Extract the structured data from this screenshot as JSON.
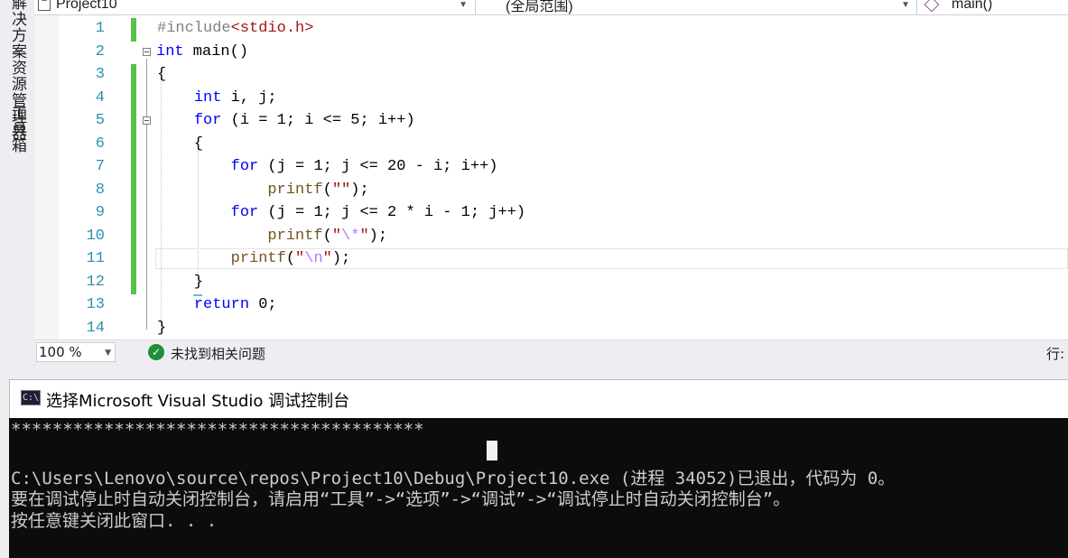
{
  "side_tabs": [
    "解决方案资源管理器",
    "工具箱"
  ],
  "nav": {
    "project": "Project10",
    "scope": "(全局范围)",
    "member": "main()"
  },
  "code": {
    "lines": [
      {
        "num": "1",
        "text": "#include<stdio.h>"
      },
      {
        "num": "2",
        "text": "int main()"
      },
      {
        "num": "3",
        "text": "{"
      },
      {
        "num": "4",
        "text": "    int i, j;"
      },
      {
        "num": "5",
        "text": "    for (i = 1; i <= 5; i++)"
      },
      {
        "num": "6",
        "text": "    {"
      },
      {
        "num": "7",
        "text": "        for (j = 1; j <= 20 - i; i++)"
      },
      {
        "num": "8",
        "text": "            printf(\"\");"
      },
      {
        "num": "9",
        "text": "        for (j = 1; j <= 2 * i - 1; j++)"
      },
      {
        "num": "10",
        "text": "            printf(\"\\*\");"
      },
      {
        "num": "11",
        "text": "        printf(\"\\n\");"
      },
      {
        "num": "12",
        "text": "    }"
      },
      {
        "num": "13",
        "text": "    return 0;"
      },
      {
        "num": "14",
        "text": "}"
      }
    ],
    "changed_lines": [
      "1",
      "3",
      "4",
      "5",
      "6",
      "7",
      "8",
      "9",
      "10",
      "11",
      "12"
    ],
    "current_line": "11"
  },
  "status": {
    "zoom": "100 %",
    "message": "未找到相关问题",
    "row_label": "行:"
  },
  "console": {
    "icon_label": "C:\\",
    "title": "选择Microsoft Visual Studio 调试控制台",
    "lines": [
      "****************************************",
      "",
      "C:\\Users\\Lenovo\\source\\repos\\Project10\\Debug\\Project10.exe (进程 34052)已退出，代码为 0。",
      "要在调试停止时自动关闭控制台，请启用“工具”->“选项”->“调试”->“调试停止时自动关闭控制台”。",
      "按任意键关闭此窗口. . ."
    ]
  },
  "colors": {
    "keyword": "#0000ff",
    "string": "#a31515",
    "line_number": "#2b91af",
    "change_bar": "#57c24a",
    "console_bg": "#0c0c0c"
  }
}
